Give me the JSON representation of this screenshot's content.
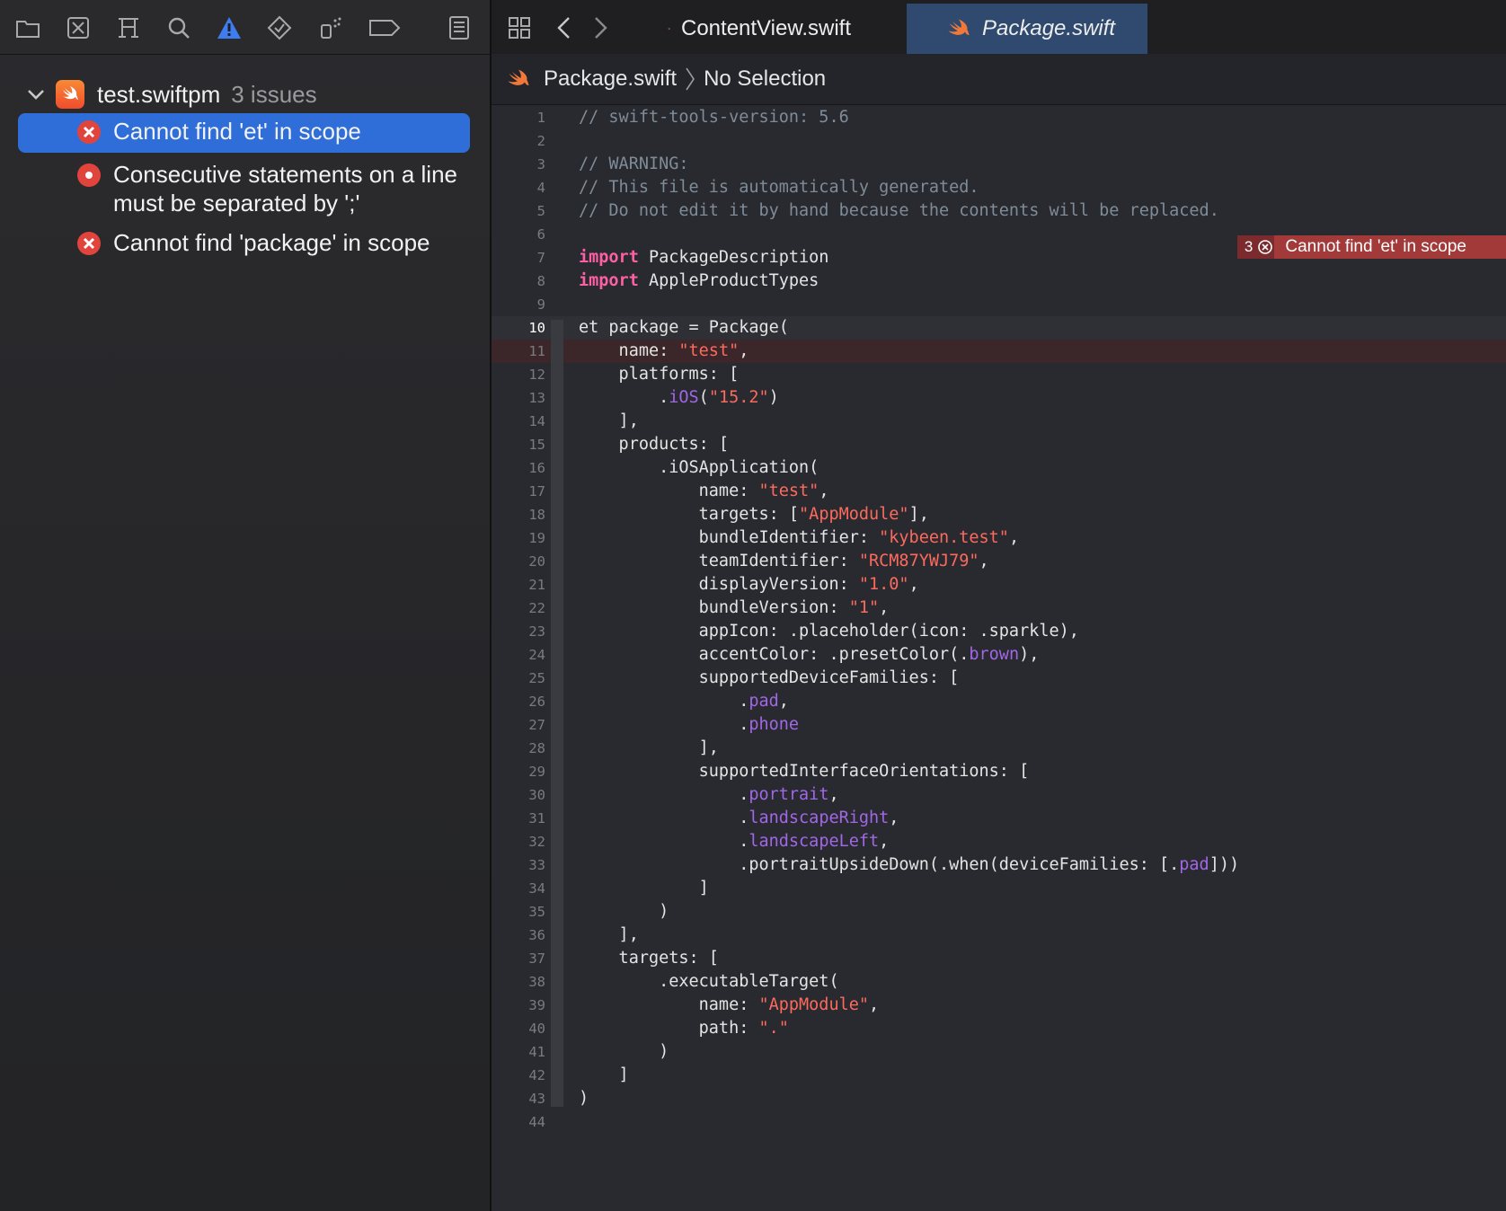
{
  "navigator": {
    "toolbar_icons": [
      "folder-icon",
      "source-control-icon",
      "hierarchy-icon",
      "search-icon",
      "issue-warning-icon",
      "test-diamond-icon",
      "debug-spray-icon",
      "breakpoint-tag-icon",
      "report-list-icon"
    ],
    "project": {
      "name": "test.swiftpm",
      "issue_count": "3 issues"
    },
    "issues": [
      {
        "text": "Cannot find 'et' in scope",
        "type": "error"
      },
      {
        "text": "Consecutive statements on a line must be separated by ';'",
        "type": "error-dot"
      },
      {
        "text": "Cannot find 'package' in scope",
        "type": "error"
      }
    ]
  },
  "editor": {
    "tabs": [
      {
        "label": "ContentView.swift",
        "active": false
      },
      {
        "label": "Package.swift",
        "active": true
      }
    ],
    "jumpbar": {
      "file": "Package.swift",
      "selection": "No Selection"
    },
    "error_banner": {
      "count": "3",
      "message": "Cannot find 'et' in scope"
    },
    "current_line": 10,
    "error_line": 11,
    "lines": [
      "// swift-tools-version: 5.6",
      "",
      "// WARNING:",
      "// This file is automatically generated.",
      "// Do not edit it by hand because the contents will be replaced.",
      "",
      "import PackageDescription",
      "import AppleProductTypes",
      "",
      "et package = Package(",
      "    name: \"test\",",
      "    platforms: [",
      "        .iOS(\"15.2\")",
      "    ],",
      "    products: [",
      "        .iOSApplication(",
      "            name: \"test\",",
      "            targets: [\"AppModule\"],",
      "            bundleIdentifier: \"kybeen.test\",",
      "            teamIdentifier: \"RCM87YWJ79\",",
      "            displayVersion: \"1.0\",",
      "            bundleVersion: \"1\",",
      "            appIcon: .placeholder(icon: .sparkle),",
      "            accentColor: .presetColor(.brown),",
      "            supportedDeviceFamilies: [",
      "                .pad,",
      "                .phone",
      "            ],",
      "            supportedInterfaceOrientations: [",
      "                .portrait,",
      "                .landscapeRight,",
      "                .landscapeLeft,",
      "                .portraitUpsideDown(.when(deviceFamilies: [.pad]))",
      "            ]",
      "        )",
      "    ],",
      "    targets: [",
      "        .executableTarget(",
      "            name: \"AppModule\",",
      "            path: \".\"",
      "        )",
      "    ]",
      ")",
      ""
    ]
  },
  "colors": {
    "selection": "#2f6ed9",
    "error": "#e0443c",
    "keyword": "#fc5fa3",
    "string": "#fc6a5d",
    "comment": "#7f8c98",
    "member": "#a167e6"
  }
}
